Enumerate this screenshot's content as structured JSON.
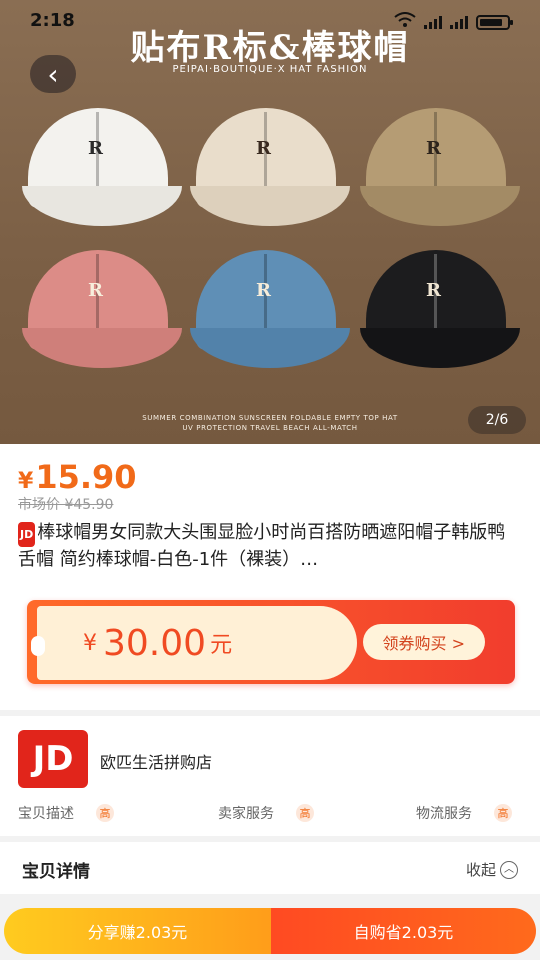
{
  "status_bar": {
    "time": "2:18"
  },
  "hero": {
    "title": "贴布R标&棒球帽",
    "subtitle": "PEIPAI·BOUTIQUE·X HAT FASHION",
    "footer_line1": "SUMMER COMBINATION SUNSCREEN FOLDABLE EMPTY TOP HAT",
    "footer_line2": "UV PROTECTION TRAVEL BEACH ALL-MATCH",
    "pager": "2/6",
    "cap_logo": "R",
    "caps": [
      {
        "color": "#f3f2ee",
        "brim": "#e8e6e0",
        "logo_color": "#2b2b2b"
      },
      {
        "color": "#e9ddcb",
        "brim": "#ddd0bc",
        "logo_color": "#3a2a20"
      },
      {
        "color": "#b59c74",
        "brim": "#a38b65",
        "logo_color": "#2d241c"
      },
      {
        "color": "#dc8c87",
        "brim": "#cf7f7a",
        "logo_color": "#f7eedc"
      },
      {
        "color": "#5f8fb6",
        "brim": "#5282aa",
        "logo_color": "#f6ecd9"
      },
      {
        "color": "#1c1c1e",
        "brim": "#141416",
        "logo_color": "#efe5d2"
      }
    ]
  },
  "product": {
    "price_symbol": "¥",
    "price": "15.90",
    "market_price": "市场价 ¥45.90",
    "jd_tag": "JD",
    "title": "棒球帽男女同款大头围显脸小时尚百搭防晒遮阳帽子韩版鸭舌帽 简约棒球帽-白色-1件（裸装）…"
  },
  "coupon": {
    "currency": "¥",
    "amount": "30.00",
    "unit": "元",
    "button": "领券购买 >"
  },
  "store": {
    "logo": "JD",
    "name": "欧匹生活拼购店",
    "ratings": [
      {
        "label": "宝贝描述",
        "level": "高"
      },
      {
        "label": "卖家服务",
        "level": "高"
      },
      {
        "label": "物流服务",
        "level": "高"
      }
    ]
  },
  "details": {
    "header": "宝贝详情",
    "toggle": "收起",
    "toggle_icon": "︿"
  },
  "bottom": {
    "share": "分享赚2.03元",
    "buy": "自购省2.03元"
  },
  "colors": {
    "accent": "#f16a19",
    "jd_red": "#e1251b"
  }
}
